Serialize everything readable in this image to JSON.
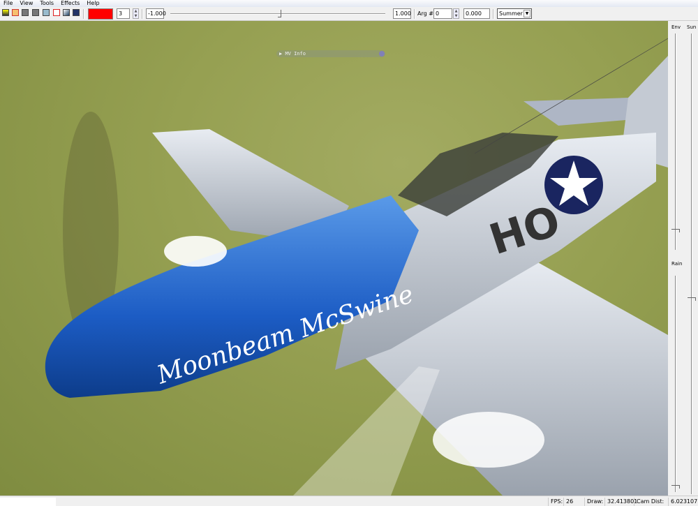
{
  "menu": [
    "File",
    "View",
    "Tools",
    "Effects",
    "Help"
  ],
  "toolbar": {
    "icons": [
      "open-icon",
      "run-icon",
      "undo-icon",
      "redo-icon",
      "screenshot-icon",
      "figure-icon",
      "search-icon",
      "layers-icon"
    ],
    "color": "#ff0000",
    "count_value": "3",
    "min_value": "-1.000",
    "max_value": "1.000",
    "slider_fraction": 0.5,
    "arg_label": "Arg #",
    "arg_value": "0",
    "arg_number": "0.000",
    "season_selected": "Summer"
  },
  "viewport": {
    "mv_info_label": "MV Info"
  },
  "right_panel": {
    "env_label": "Env",
    "sun_label": "Sun",
    "rain_label": "Rain"
  },
  "status": {
    "fps_label": "FPS:",
    "fps_value": "26",
    "draw_label": "Draw:",
    "draw_value": "32.413801",
    "cam_label": "Cam Dist:",
    "cam_value": "6.023107"
  }
}
